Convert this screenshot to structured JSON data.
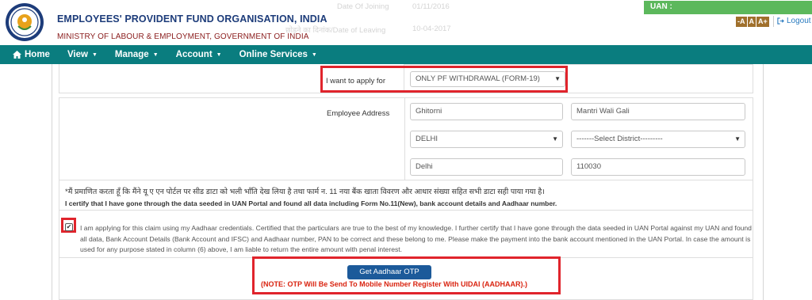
{
  "header": {
    "org_title": "EMPLOYEES' PROVIDENT FUND ORGANISATION, INDIA",
    "ministry": "MINISTRY OF LABOUR & EMPLOYMENT, GOVERNMENT OF INDIA",
    "ghost_date_joining": "Date Of Joining",
    "ghost_date_leaving": "छोड़ने का दिनांक/Date of Leaving",
    "ghost_value_1": "01/11/2016",
    "ghost_value_2": "10-04-2017",
    "uan_label": "UAN :",
    "font_sizes": [
      "-A",
      "A",
      "A+"
    ],
    "logout_label": "Logout"
  },
  "nav": {
    "home": "Home",
    "view": "View",
    "manage": "Manage",
    "account": "Account",
    "online_services": "Online Services"
  },
  "form": {
    "apply_label": "I want to apply for",
    "apply_value": "ONLY PF WITHDRAWAL (FORM-19)",
    "address_label": "Employee Address",
    "address_line1": "Ghitorni",
    "address_line2": "Mantri Wali Gali",
    "state": "DELHI",
    "district_placeholder": "-------Select District---------",
    "city": "Delhi",
    "pincode": "110030"
  },
  "certification": {
    "hindi": "*मैं प्रमाणित करता हूँ कि मैंने यू ए एन पोर्टल पर सीड डाटा को भली भाँति देख लिया है तथा फार्म न. 11 नया बैंक खाता विवरण और आधार संख्या सहित सभी डाटा सही पाया गया है।",
    "english": "I certify that I have gone through the data seeded in UAN Portal and found all data including Form No.11(New), bank account details and Aadhaar number.",
    "declaration": "I am applying for this claim using my Aadhaar credentials. Certified that the particulars are true to the best of my knowledge. I further certify that I have gone through the data seeded in UAN Portal against my UAN and found all data, Bank Account Details (Bank Account and IFSC) and Aadhaar number, PAN to be correct and these belong to me. Please make the payment into the bank account mentioned in the UAN Portal. In case the amount is used for any purpose stated in column (6) above, I am liable to return the entire amount with penal interest.",
    "checkbox_checked": true
  },
  "otp": {
    "button_label": "Get Aadhaar OTP",
    "note": "(NOTE: OTP Will Be Send To Mobile Number Register With UIDAI (AADHAAR).)"
  },
  "colors": {
    "nav_bg": "#0a7d7f",
    "uan_badge": "#5cb85c",
    "highlight": "#e0242c",
    "otp_button": "#1c5a9a",
    "note_red": "#d9230f"
  }
}
